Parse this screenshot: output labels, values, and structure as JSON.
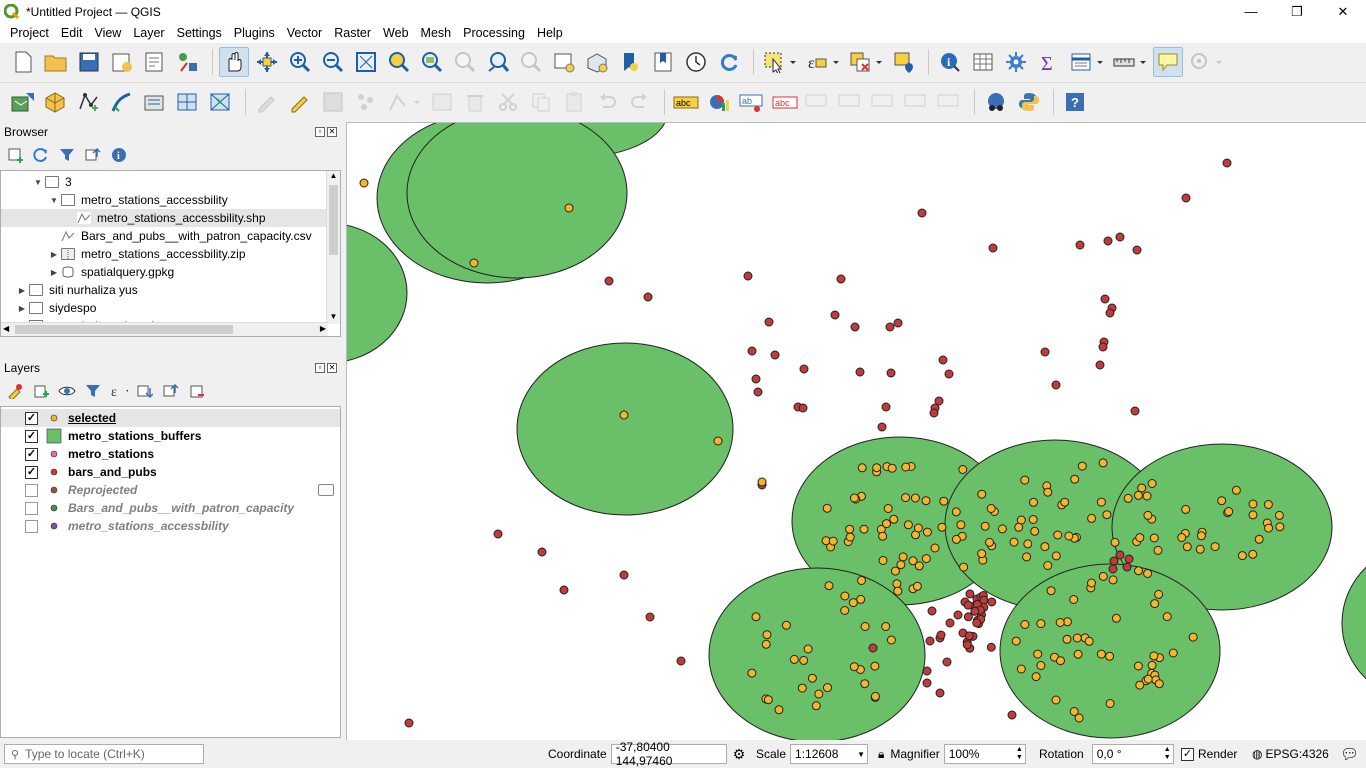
{
  "window": {
    "title": "*Untitled Project — QGIS",
    "min": "—",
    "restore": "❐",
    "close": "✕"
  },
  "menu": [
    "Project",
    "Edit",
    "View",
    "Layer",
    "Settings",
    "Plugins",
    "Vector",
    "Raster",
    "Web",
    "Mesh",
    "Processing",
    "Help"
  ],
  "browser": {
    "title": "Browser",
    "items": [
      {
        "label": "3",
        "indent": 1,
        "expanded": true,
        "icon": "folder-icon"
      },
      {
        "label": "metro_stations_accessbility",
        "indent": 2,
        "expanded": true,
        "icon": "folder-icon"
      },
      {
        "label": "metro_stations_accessbility.shp",
        "indent": 3,
        "icon": "shapefile-icon",
        "selected": true
      },
      {
        "label": "Bars_and_pubs__with_patron_capacity.csv",
        "indent": 2,
        "icon": "csv-icon"
      },
      {
        "label": "metro_stations_accessbility.zip",
        "indent": 2,
        "expanded": false,
        "icon": "zip-icon"
      },
      {
        "label": "spatialquery.gpkg",
        "indent": 2,
        "expanded": false,
        "icon": "geopackage-icon"
      },
      {
        "label": "siti nurhaliza yus",
        "indent": 0,
        "expanded": false,
        "icon": "folder-icon"
      },
      {
        "label": "siydespo",
        "indent": 0,
        "expanded": false,
        "icon": "folder-icon"
      },
      {
        "label": "tugas bahasa inggris",
        "indent": 0,
        "expanded": false,
        "icon": "folder-icon"
      }
    ]
  },
  "layers": {
    "title": "Layers",
    "items": [
      {
        "label": "selected",
        "checked": true,
        "visible": true,
        "symbol": "point",
        "color": "#f0b429",
        "selected": true
      },
      {
        "label": "metro_stations_buffers",
        "checked": true,
        "visible": true,
        "symbol": "polygon",
        "color": "#6abf69"
      },
      {
        "label": "metro_stations",
        "checked": true,
        "visible": true,
        "symbol": "point",
        "color": "#e06bb0"
      },
      {
        "label": "bars_and_pubs",
        "checked": true,
        "visible": true,
        "symbol": "point",
        "color": "#c23b3b"
      },
      {
        "label": "Reprojected",
        "checked": false,
        "visible": false,
        "symbol": "point",
        "color": "#8b5a3c",
        "extra": "virtual-layer-icon"
      },
      {
        "label": "Bars_and_pubs__with_patron_capacity",
        "checked": false,
        "visible": false,
        "symbol": "point",
        "color": "#4d8a4d"
      },
      {
        "label": "metro_stations_accessbility",
        "checked": false,
        "visible": false,
        "symbol": "point",
        "color": "#7a4d9e"
      }
    ]
  },
  "colors": {
    "buffer": "#6abf69",
    "selected": "#f5b52b",
    "bars": "#c23b3b",
    "outline": "#222"
  },
  "status": {
    "locate_placeholder": "Type to locate (Ctrl+K)",
    "coordinate_label": "Coordinate",
    "coordinate_value": "-37,80400 144,97460",
    "scale_label": "Scale",
    "scale_value": "1:12608",
    "magnifier_label": "Magnifier",
    "magnifier_value": "100%",
    "rotation_label": "Rotation",
    "rotation_value": "0,0 °",
    "render_label": "Render",
    "crs": "EPSG:4326"
  }
}
